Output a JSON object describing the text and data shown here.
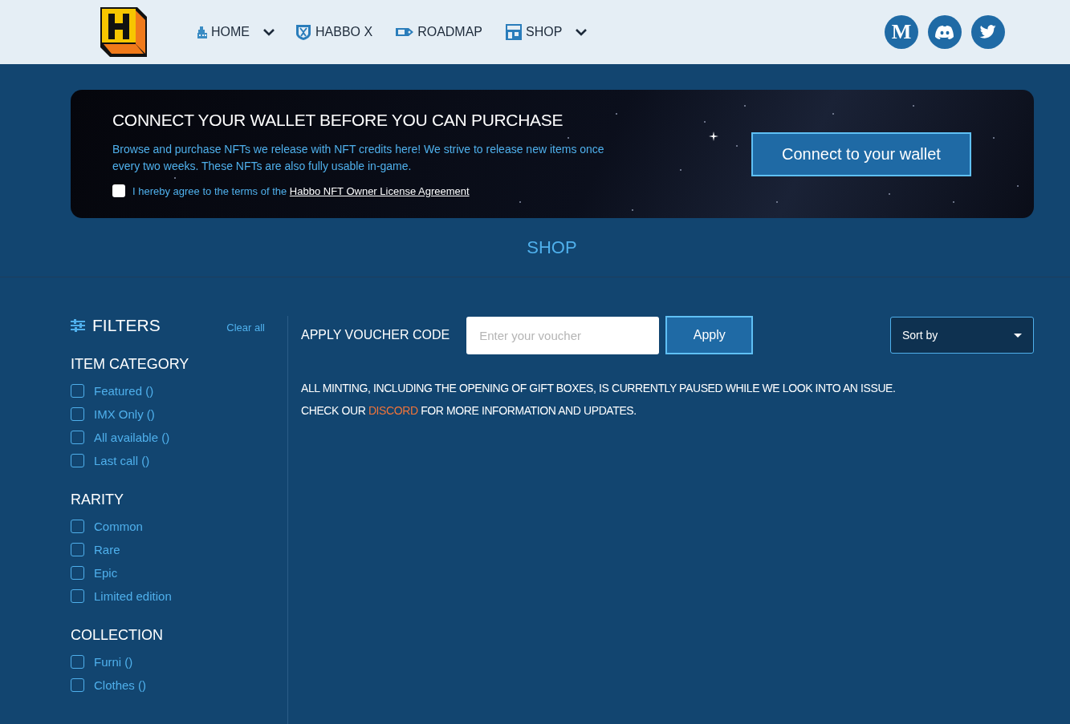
{
  "header": {
    "nav": [
      {
        "label": "HOME",
        "has_menu": true
      },
      {
        "label": "HABBO X",
        "has_menu": false
      },
      {
        "label": "ROADMAP",
        "has_menu": false
      },
      {
        "label": "SHOP",
        "has_menu": true
      }
    ],
    "social": [
      {
        "kind": "medium",
        "label": "M"
      },
      {
        "kind": "discord"
      },
      {
        "kind": "twitter"
      }
    ]
  },
  "banner": {
    "title": "CONNECT YOUR WALLET BEFORE YOU CAN PURCHASE",
    "text": "Browse and purchase NFTs we release with NFT credits here! We strive to release new items once every two weeks. These NFTs are also fully usable in-game.",
    "agree": {
      "text": "I hereby agree to the terms of the",
      "link": "Habbo NFT Owner License Agreement",
      "checked": false
    },
    "button": "Connect to your wallet"
  },
  "page_title": "SHOP",
  "filters": {
    "title": "FILTERS",
    "clear": "Clear all",
    "groups": [
      {
        "title": "ITEM CATEGORY",
        "options": [
          {
            "label": "Featured ()",
            "checked": false
          },
          {
            "label": "IMX Only ()",
            "checked": false
          },
          {
            "label": "All available ()",
            "checked": false
          },
          {
            "label": "Last call ()",
            "checked": false
          }
        ]
      },
      {
        "title": "RARITY",
        "options": [
          {
            "label": "Common",
            "checked": false
          },
          {
            "label": "Rare",
            "checked": false
          },
          {
            "label": "Epic",
            "checked": false
          },
          {
            "label": "Limited edition",
            "checked": false
          }
        ]
      },
      {
        "title": "COLLECTION",
        "options": [
          {
            "label": "Furni ()",
            "checked": false
          },
          {
            "label": "Clothes ()",
            "checked": false
          }
        ]
      }
    ]
  },
  "voucher": {
    "label": "APPLY VOUCHER CODE",
    "placeholder": "Enter your voucher",
    "button": "Apply"
  },
  "sort": {
    "placeholder": "Sort by"
  },
  "notice": {
    "line_1": "ALL MINTING, INCLUDING THE OPENING OF GIFT BOXES, IS CURRENTLY PAUSED WHILE WE LOOK INTO AN ISSUE.",
    "line_2_start": "CHECK OUR",
    "link": "DISCORD",
    "line_2_end": "FOR MORE INFORMATION AND UPDATES."
  }
}
